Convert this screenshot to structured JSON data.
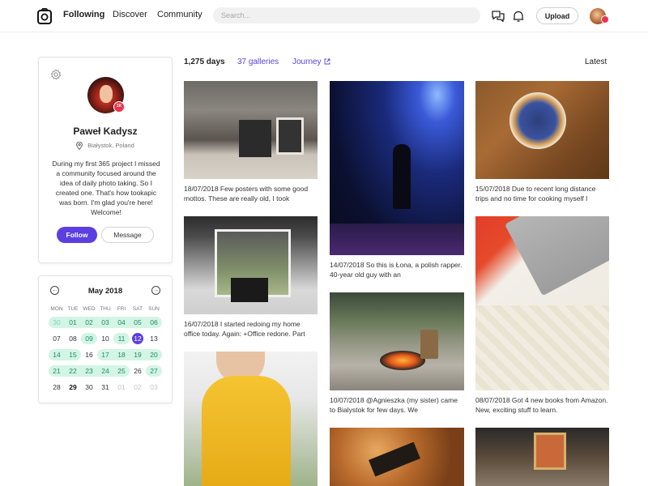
{
  "header": {
    "logo_icon": "camera-logo-icon",
    "nav": [
      {
        "label": "Following",
        "active": true
      },
      {
        "label": "Discover",
        "active": false
      },
      {
        "label": "Community",
        "active": false
      }
    ],
    "search_placeholder": "Search...",
    "icons": [
      "chat-icon",
      "bell-icon"
    ],
    "upload_label": "Upload"
  },
  "profile": {
    "name": "Paweł Kadysz",
    "location": "Białystok, Poland",
    "badge": "1K",
    "bio": "During my first 365 project I missed a community focused around the idea of daily photo taking. So I created one. That's how tookapic was born. I'm glad you're here! Welcome!",
    "follow_label": "Follow",
    "message_label": "Message"
  },
  "calendar": {
    "month": "May 2018",
    "weekdays": [
      "MON",
      "TUE",
      "WED",
      "THU",
      "FRI",
      "SAT",
      "SUN"
    ],
    "weeks": [
      [
        "30",
        "01",
        "02",
        "03",
        "04",
        "05",
        "06"
      ],
      [
        "07",
        "08",
        "09",
        "10",
        "11",
        "12",
        "13"
      ],
      [
        "14",
        "15",
        "16",
        "17",
        "18",
        "19",
        "20"
      ],
      [
        "21",
        "22",
        "23",
        "24",
        "25",
        "26",
        "27"
      ],
      [
        "28",
        "29",
        "30",
        "31",
        "01",
        "02",
        "03"
      ]
    ],
    "selected_day": "12",
    "today_day": "29"
  },
  "stats": {
    "days": "1,275 days",
    "galleries": "37 galleries",
    "journey": "Journey",
    "sort": "Latest"
  },
  "photos": [
    {
      "caption": "18/07/2018 Few posters with some good mottos. These are really old, I took"
    },
    {
      "caption": "14/07/2018 So this is Łona, a polish rapper. 40-year old guy with an"
    },
    {
      "caption": "15/07/2018 Due to recent long distance trips and no time for cooking myself I"
    },
    {
      "caption": "16/07/2018 I started redoing my home office today. Again: +Office redone. Part"
    },
    {
      "caption": "10/07/2018 @Agnieszka (my sister) came to Bialystok for few days. We"
    },
    {
      "caption": "08/07/2018 Got 4 new books from Amazon. New, exciting stuff to learn."
    }
  ],
  "colors": {
    "accent": "#5b3fe0",
    "highlight": "#d2f5e6",
    "badge": "#e8344e"
  }
}
